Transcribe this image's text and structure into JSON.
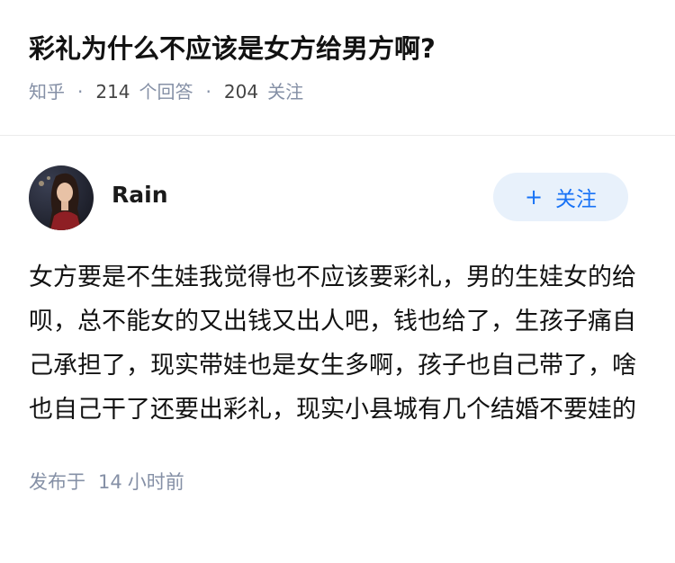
{
  "question": {
    "title": "彩礼为什么不应该是女方给男方啊?",
    "site": "知乎",
    "answers_count": "214",
    "answers_label": "个回答",
    "followers_count": "204",
    "followers_label": "关注"
  },
  "answer": {
    "author_name": "Rain",
    "follow_label": "关注",
    "content": "女方要是不生娃我觉得也不应该要彩礼，男的生娃女的给呗，总不能女的又出钱又出人吧，钱也给了，生孩子痛自己承担了，现实带娃也是女生多啊，孩子也自己带了，啥也自己干了还要出彩礼，现实小县城有几个结婚不要娃的",
    "time_prefix": "发布于",
    "time_value": "14",
    "time_unit": "小时前"
  },
  "colors": {
    "accent": "#1772f6",
    "button_bg": "#e8f1fb",
    "meta_gray": "#8590a6"
  }
}
